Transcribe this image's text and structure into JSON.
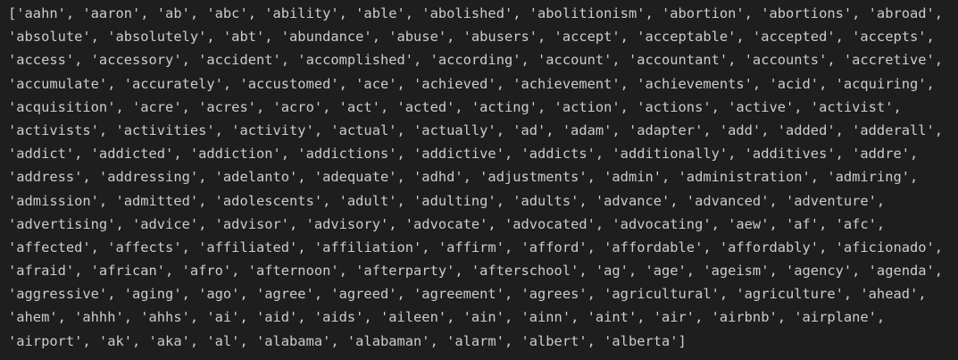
{
  "output": {
    "lines": [
      "['aahn', 'aaron', 'ab', 'abc', 'ability', 'able', 'abolished', 'abolitionism', 'abortion', 'abortions', 'abroad',",
      "'absolute', 'absolutely', 'abt', 'abundance', 'abuse', 'abusers', 'accept', 'acceptable', 'accepted', 'accepts',",
      "'access', 'accessory', 'accident', 'accomplished', 'according', 'account', 'accountant', 'accounts', 'accretive',",
      "'accumulate', 'accurately', 'accustomed', 'ace', 'achieved', 'achievement', 'achievements', 'acid', 'acquiring',",
      "'acquisition', 'acre', 'acres', 'acro', 'act', 'acted', 'acting', 'action', 'actions', 'active', 'activist',",
      "'activists', 'activities', 'activity', 'actual', 'actually', 'ad', 'adam', 'adapter', 'add', 'added', 'adderall',",
      "'addict', 'addicted', 'addiction', 'addictions', 'addictive', 'addicts', 'additionally', 'additives', 'addre',",
      "'address', 'addressing', 'adelanto', 'adequate', 'adhd', 'adjustments', 'admin', 'administration', 'admiring',",
      "'admission', 'admitted', 'adolescents', 'adult', 'adulting', 'adults', 'advance', 'advanced', 'adventure',",
      "'advertising', 'advice', 'advisor', 'advisory', 'advocate', 'advocated', 'advocating', 'aew', 'af', 'afc',",
      "'affected', 'affects', 'affiliated', 'affiliation', 'affirm', 'afford', 'affordable', 'affordably', 'aficionado',",
      "'afraid', 'african', 'afro', 'afternoon', 'afterparty', 'afterschool', 'ag', 'age', 'ageism', 'agency', 'agenda',",
      "'aggressive', 'aging', 'ago', 'agree', 'agreed', 'agreement', 'agrees', 'agricultural', 'agriculture', 'ahead',",
      "'ahem', 'ahhh', 'ahhs', 'ai', 'aid', 'aids', 'aileen', 'ain', 'ainn', 'aint', 'air', 'airbnb', 'airplane',",
      "'airport', 'ak', 'aka', 'al', 'alabama', 'alabaman', 'alarm', 'albert', 'alberta']"
    ]
  },
  "colors": {
    "background": "#1e1e1e",
    "text": "#cccccc"
  }
}
